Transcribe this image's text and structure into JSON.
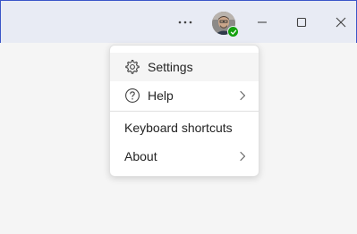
{
  "titlebar": {
    "more_icon": "ellipsis-icon",
    "avatar": {
      "status": "available",
      "status_color": "#13a10e"
    },
    "minimize_icon": "minimize-icon",
    "maximize_icon": "maximize-icon",
    "close_icon": "close-icon",
    "accent_color": "#3b56c8"
  },
  "menu": {
    "items": [
      {
        "label": "Settings",
        "icon": "gear-icon",
        "has_submenu": false,
        "highlighted": true
      },
      {
        "label": "Help",
        "icon": "help-circle-icon",
        "has_submenu": true
      },
      {
        "label": "Keyboard shortcuts",
        "icon": "",
        "has_submenu": false
      },
      {
        "label": "About",
        "icon": "",
        "has_submenu": true
      }
    ]
  }
}
